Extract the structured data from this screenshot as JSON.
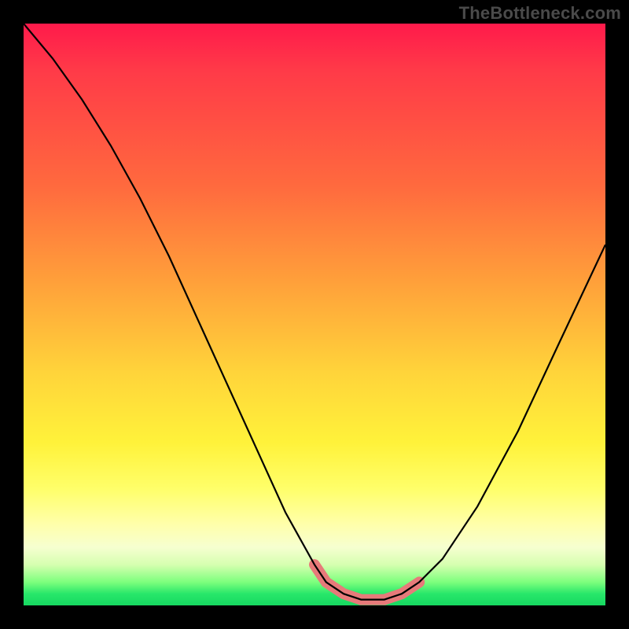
{
  "watermark": "TheBottleneck.com",
  "colors": {
    "background": "#000000",
    "curve": "#000000",
    "highlight": "#e77a7a",
    "gradient_top": "#ff1a4b",
    "gradient_bottom": "#16d860"
  },
  "chart_data": {
    "type": "line",
    "title": "",
    "xlabel": "",
    "ylabel": "",
    "xlim": [
      0,
      100
    ],
    "ylim": [
      0,
      100
    ],
    "grid": false,
    "series": [
      {
        "name": "bottleneck-curve",
        "x": [
          0,
          5,
          10,
          15,
          20,
          25,
          30,
          35,
          40,
          45,
          50,
          52,
          55,
          58,
          62,
          65,
          68,
          72,
          78,
          85,
          92,
          100
        ],
        "y": [
          100,
          94,
          87,
          79,
          70,
          60,
          49,
          38,
          27,
          16,
          7,
          4,
          2,
          1,
          1,
          2,
          4,
          8,
          17,
          30,
          45,
          62
        ]
      }
    ],
    "highlight_range": {
      "x_start": 50,
      "x_end": 68
    },
    "annotations": []
  }
}
